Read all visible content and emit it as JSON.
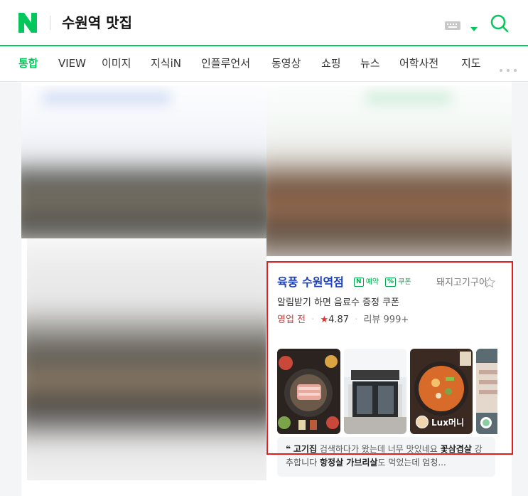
{
  "header": {
    "logo": "N",
    "query": "수원역 맛집",
    "icons": [
      "keyboard-icon",
      "chevron-down-icon",
      "search-icon"
    ],
    "brand_color": "#03c75a"
  },
  "tabs": [
    {
      "label": "통합",
      "active": true
    },
    {
      "label": "VIEW"
    },
    {
      "label": "이미지"
    },
    {
      "label": "지식iN"
    },
    {
      "label": "인플루언서"
    },
    {
      "label": "동영상"
    },
    {
      "label": "쇼핑"
    },
    {
      "label": "뉴스"
    },
    {
      "label": "어학사전"
    },
    {
      "label": "지도"
    }
  ],
  "place": {
    "name": "육풍 수원역점",
    "badge_reserve": "예약",
    "badge_reserve_box": "N",
    "badge_coupon": "쿠폰",
    "badge_coupon_box": "%",
    "category": "돼지고기구이",
    "promo": "알림받기 하면 음료수 증정 쿠폰",
    "status": "영업 전",
    "rating": "4.87",
    "reviews": "리뷰 999+",
    "photo_label": "Lux머니",
    "review_snippet": {
      "quote_mark": "❝",
      "part1_bold": "고기집",
      "part2": " 검색하다가 왔는데 너무 맛있네요 ",
      "part3_bold": "꽃삼겹살",
      "part4": " 강추합니다 ",
      "part5_bold": "항정살 가브리살",
      "part6": "도 먹었는데 엄청..."
    }
  }
}
